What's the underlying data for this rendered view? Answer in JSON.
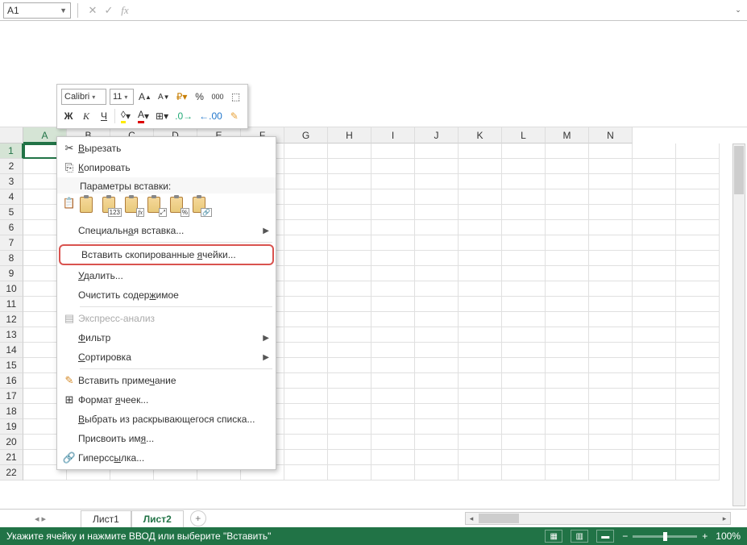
{
  "formula_bar": {
    "name_box": "A1",
    "cancel": "✕",
    "confirm": "✓",
    "fx": "fx"
  },
  "mini_toolbar": {
    "font": "Calibri",
    "size": "11",
    "increase": "A",
    "decrease": "A",
    "percent": "%",
    "thousands": "000"
  },
  "columns": [
    "A",
    "B",
    "C",
    "D",
    "E",
    "F",
    "G",
    "H",
    "I",
    "J",
    "K",
    "L",
    "M",
    "N"
  ],
  "context_menu": {
    "cut": "Вырезать",
    "copy": "Копировать",
    "paste_options": "Параметры вставки:",
    "paste_subs": [
      "",
      "123",
      "fx",
      "%",
      "",
      ""
    ],
    "paste_special": "Специальная вставка...",
    "insert_copied": "Вставить скопированные ячейки...",
    "delete": "Удалить...",
    "clear": "Очистить содержимое",
    "quick_analysis": "Экспресс-анализ",
    "filter": "Фильтр",
    "sort": "Сортировка",
    "insert_comment": "Вставить примечание",
    "format_cells": "Формат ячеек...",
    "dropdown_list": "Выбрать из раскрывающегося списка...",
    "define_name": "Присвоить имя...",
    "hyperlink": "Гиперссылка..."
  },
  "tabs": {
    "sheet1": "Лист1",
    "sheet2": "Лист2"
  },
  "status": {
    "message": "Укажите ячейку и нажмите ВВОД или выберите \"Вставить\"",
    "zoom": "100%"
  }
}
